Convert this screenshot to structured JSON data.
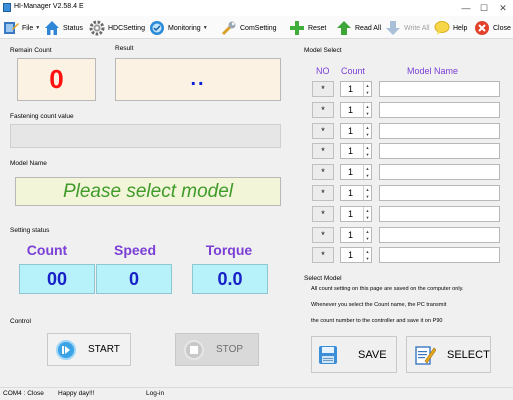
{
  "window": {
    "title": "HI-Manager  V2.58.4 E",
    "minimize": "—",
    "maximize": "☐",
    "close": "✕"
  },
  "toolbar": {
    "file": "File",
    "status": "Status",
    "hdcsetting": "HDCSetting",
    "monitoring": "Monitoring",
    "comsetting": "ComSetting",
    "reset": "Reset",
    "read_all": "Read All",
    "write_all": "Write All",
    "help": "Help",
    "close": "Close"
  },
  "left": {
    "remain_count_label": "Remain Count",
    "remain_count_value": "0",
    "result_label": "Result",
    "result_value": "..",
    "fastening_label": "Fastening count value",
    "fastening_value": "",
    "model_name_label": "Model Name",
    "model_name_value": "Please select model",
    "setting_status_label": "Setting status",
    "count_label": "Count",
    "count_value": "00",
    "speed_label": "Speed",
    "speed_value": "0",
    "torque_label": "Torque",
    "torque_value": "0.0",
    "control_label": "Control",
    "start_label": "START",
    "stop_label": "STOP"
  },
  "right": {
    "model_select_label": "Model Select",
    "col_no": "NO",
    "col_count": "Count",
    "col_model_name": "Model Name",
    "rows": [
      {
        "no": "*",
        "count": "1",
        "name": ""
      },
      {
        "no": "*",
        "count": "1",
        "name": ""
      },
      {
        "no": "*",
        "count": "1",
        "name": ""
      },
      {
        "no": "*",
        "count": "1",
        "name": ""
      },
      {
        "no": "*",
        "count": "1",
        "name": ""
      },
      {
        "no": "*",
        "count": "1",
        "name": ""
      },
      {
        "no": "*",
        "count": "1",
        "name": ""
      },
      {
        "no": "*",
        "count": "1",
        "name": ""
      },
      {
        "no": "*",
        "count": "1",
        "name": ""
      }
    ],
    "select_model_label": "Select Model",
    "info_line1": "All count setting on this page are saved on the computer only.",
    "info_line2": "Whenever you select the Count name, the PC transmit",
    "info_line3": "the count number to the controller and save it on P90",
    "save_label": "SAVE",
    "select_label": "SELECT"
  },
  "statusbar": {
    "port": "COM4 : Close",
    "message": "Happy day!!!",
    "login": "Log-in"
  },
  "colors": {
    "remain_count": "#ff1010",
    "result": "#0b1fd6",
    "model_name": "#3f9b2a",
    "setting_headers": "#7b3fd6",
    "setting_values_bg": "#b7f1f9"
  }
}
